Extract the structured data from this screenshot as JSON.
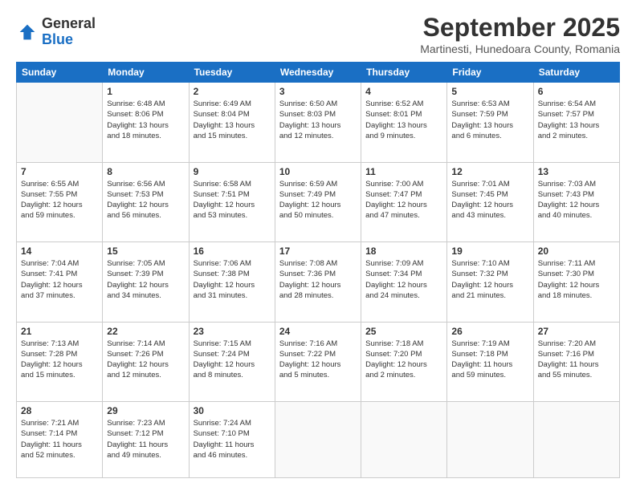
{
  "header": {
    "logo_general": "General",
    "logo_blue": "Blue",
    "month_year": "September 2025",
    "location": "Martinesti, Hunedoara County, Romania"
  },
  "days_of_week": [
    "Sunday",
    "Monday",
    "Tuesday",
    "Wednesday",
    "Thursday",
    "Friday",
    "Saturday"
  ],
  "weeks": [
    [
      {
        "day": "",
        "info": ""
      },
      {
        "day": "1",
        "info": "Sunrise: 6:48 AM\nSunset: 8:06 PM\nDaylight: 13 hours\nand 18 minutes."
      },
      {
        "day": "2",
        "info": "Sunrise: 6:49 AM\nSunset: 8:04 PM\nDaylight: 13 hours\nand 15 minutes."
      },
      {
        "day": "3",
        "info": "Sunrise: 6:50 AM\nSunset: 8:03 PM\nDaylight: 13 hours\nand 12 minutes."
      },
      {
        "day": "4",
        "info": "Sunrise: 6:52 AM\nSunset: 8:01 PM\nDaylight: 13 hours\nand 9 minutes."
      },
      {
        "day": "5",
        "info": "Sunrise: 6:53 AM\nSunset: 7:59 PM\nDaylight: 13 hours\nand 6 minutes."
      },
      {
        "day": "6",
        "info": "Sunrise: 6:54 AM\nSunset: 7:57 PM\nDaylight: 13 hours\nand 2 minutes."
      }
    ],
    [
      {
        "day": "7",
        "info": "Sunrise: 6:55 AM\nSunset: 7:55 PM\nDaylight: 12 hours\nand 59 minutes."
      },
      {
        "day": "8",
        "info": "Sunrise: 6:56 AM\nSunset: 7:53 PM\nDaylight: 12 hours\nand 56 minutes."
      },
      {
        "day": "9",
        "info": "Sunrise: 6:58 AM\nSunset: 7:51 PM\nDaylight: 12 hours\nand 53 minutes."
      },
      {
        "day": "10",
        "info": "Sunrise: 6:59 AM\nSunset: 7:49 PM\nDaylight: 12 hours\nand 50 minutes."
      },
      {
        "day": "11",
        "info": "Sunrise: 7:00 AM\nSunset: 7:47 PM\nDaylight: 12 hours\nand 47 minutes."
      },
      {
        "day": "12",
        "info": "Sunrise: 7:01 AM\nSunset: 7:45 PM\nDaylight: 12 hours\nand 43 minutes."
      },
      {
        "day": "13",
        "info": "Sunrise: 7:03 AM\nSunset: 7:43 PM\nDaylight: 12 hours\nand 40 minutes."
      }
    ],
    [
      {
        "day": "14",
        "info": "Sunrise: 7:04 AM\nSunset: 7:41 PM\nDaylight: 12 hours\nand 37 minutes."
      },
      {
        "day": "15",
        "info": "Sunrise: 7:05 AM\nSunset: 7:39 PM\nDaylight: 12 hours\nand 34 minutes."
      },
      {
        "day": "16",
        "info": "Sunrise: 7:06 AM\nSunset: 7:38 PM\nDaylight: 12 hours\nand 31 minutes."
      },
      {
        "day": "17",
        "info": "Sunrise: 7:08 AM\nSunset: 7:36 PM\nDaylight: 12 hours\nand 28 minutes."
      },
      {
        "day": "18",
        "info": "Sunrise: 7:09 AM\nSunset: 7:34 PM\nDaylight: 12 hours\nand 24 minutes."
      },
      {
        "day": "19",
        "info": "Sunrise: 7:10 AM\nSunset: 7:32 PM\nDaylight: 12 hours\nand 21 minutes."
      },
      {
        "day": "20",
        "info": "Sunrise: 7:11 AM\nSunset: 7:30 PM\nDaylight: 12 hours\nand 18 minutes."
      }
    ],
    [
      {
        "day": "21",
        "info": "Sunrise: 7:13 AM\nSunset: 7:28 PM\nDaylight: 12 hours\nand 15 minutes."
      },
      {
        "day": "22",
        "info": "Sunrise: 7:14 AM\nSunset: 7:26 PM\nDaylight: 12 hours\nand 12 minutes."
      },
      {
        "day": "23",
        "info": "Sunrise: 7:15 AM\nSunset: 7:24 PM\nDaylight: 12 hours\nand 8 minutes."
      },
      {
        "day": "24",
        "info": "Sunrise: 7:16 AM\nSunset: 7:22 PM\nDaylight: 12 hours\nand 5 minutes."
      },
      {
        "day": "25",
        "info": "Sunrise: 7:18 AM\nSunset: 7:20 PM\nDaylight: 12 hours\nand 2 minutes."
      },
      {
        "day": "26",
        "info": "Sunrise: 7:19 AM\nSunset: 7:18 PM\nDaylight: 11 hours\nand 59 minutes."
      },
      {
        "day": "27",
        "info": "Sunrise: 7:20 AM\nSunset: 7:16 PM\nDaylight: 11 hours\nand 55 minutes."
      }
    ],
    [
      {
        "day": "28",
        "info": "Sunrise: 7:21 AM\nSunset: 7:14 PM\nDaylight: 11 hours\nand 52 minutes."
      },
      {
        "day": "29",
        "info": "Sunrise: 7:23 AM\nSunset: 7:12 PM\nDaylight: 11 hours\nand 49 minutes."
      },
      {
        "day": "30",
        "info": "Sunrise: 7:24 AM\nSunset: 7:10 PM\nDaylight: 11 hours\nand 46 minutes."
      },
      {
        "day": "",
        "info": ""
      },
      {
        "day": "",
        "info": ""
      },
      {
        "day": "",
        "info": ""
      },
      {
        "day": "",
        "info": ""
      }
    ]
  ]
}
